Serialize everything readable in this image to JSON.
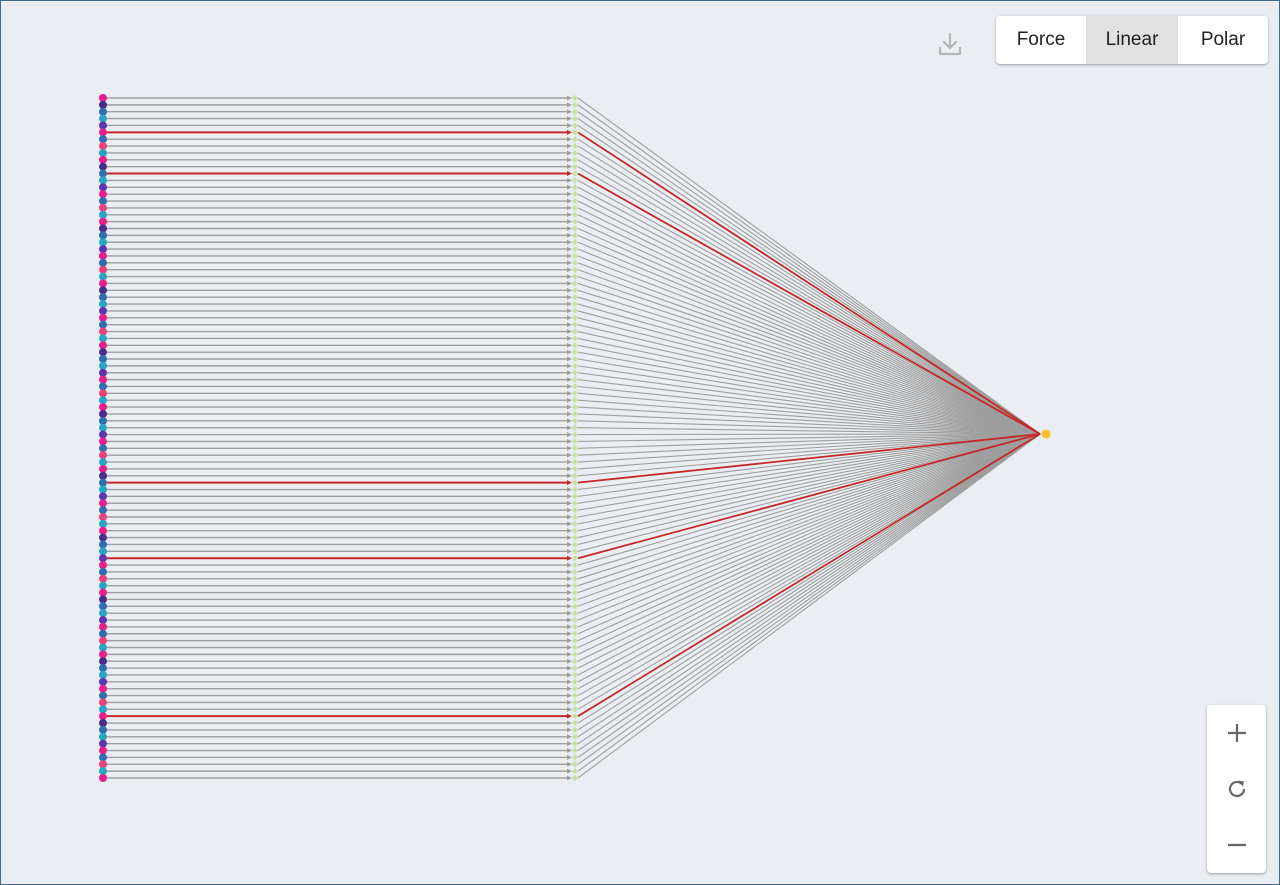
{
  "toolbar": {
    "download_icon": "download-icon",
    "layouts": [
      {
        "label": "Force",
        "active": false
      },
      {
        "label": "Linear",
        "active": true
      },
      {
        "label": "Polar",
        "active": false
      }
    ]
  },
  "graph": {
    "source_count": 100,
    "highlighted_paths": [
      5,
      11,
      56,
      67,
      90
    ],
    "source_caption": "",
    "target_caption": "",
    "colors": {
      "edge": "#9e9e9e",
      "highlight": "#c62828",
      "middle_node": "#c5e1a5",
      "target_node": "#fbc02d",
      "source_palette": [
        "#e91e8c",
        "#4a2c8a",
        "#2f6fb0",
        "#ec407a",
        "#26a6c4",
        "#5e35b1"
      ]
    }
  },
  "zoom": {
    "in_icon": "plus-icon",
    "reset_icon": "reset-icon",
    "out_icon": "minus-icon"
  }
}
